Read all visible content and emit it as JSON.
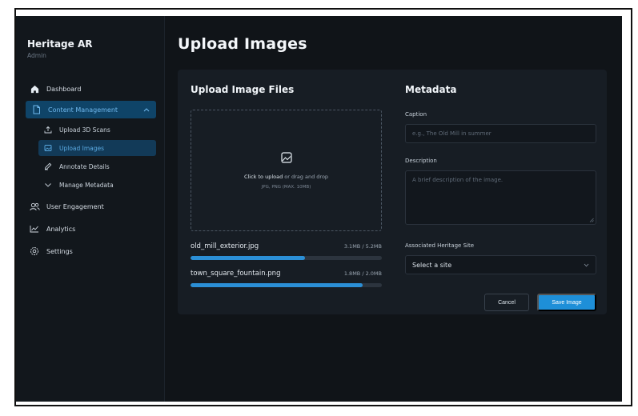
{
  "brand": {
    "title": "Heritage AR",
    "subtitle": "Admin"
  },
  "sidebar": {
    "items": [
      {
        "label": "Dashboard",
        "icon": "home-icon"
      },
      {
        "label": "Content Management",
        "icon": "document-icon",
        "expanded": true,
        "children": [
          {
            "label": "Upload 3D Scans",
            "icon": "upload-icon"
          },
          {
            "label": "Upload Images",
            "icon": "image-icon",
            "active": true
          },
          {
            "label": "Annotate Details",
            "icon": "edit-icon"
          },
          {
            "label": "Manage Metadata",
            "icon": "chevron-down-icon"
          }
        ]
      },
      {
        "label": "User Engagement",
        "icon": "users-icon"
      },
      {
        "label": "Analytics",
        "icon": "chart-icon"
      },
      {
        "label": "Settings",
        "icon": "gear-icon"
      }
    ]
  },
  "page": {
    "title": "Upload Images"
  },
  "upload": {
    "title": "Upload Image Files",
    "dropzone": {
      "action": "Click to upload",
      "rest": " or drag and drop",
      "hint": "JPG, PNG (MAX. 10MB)"
    },
    "files": [
      {
        "name": "old_mill_exterior.jpg",
        "size": "3.1MB / 5.2MB",
        "progress": 0.6
      },
      {
        "name": "town_square_fountain.png",
        "size": "1.8MB / 2.0MB",
        "progress": 0.9
      }
    ]
  },
  "metadata": {
    "title": "Metadata",
    "caption": {
      "label": "Caption",
      "placeholder": "e.g., The Old Mill in summer"
    },
    "description": {
      "label": "Description",
      "placeholder": "A brief description of the image."
    },
    "site": {
      "label": "Associated Heritage Site",
      "value": "Select a site"
    },
    "cancel_label": "Cancel",
    "save_label": "Save Image"
  },
  "colors": {
    "accent": "#1e8fd8",
    "background": "#101418",
    "card": "#171d24",
    "sidebar_active": "#0f4468"
  }
}
